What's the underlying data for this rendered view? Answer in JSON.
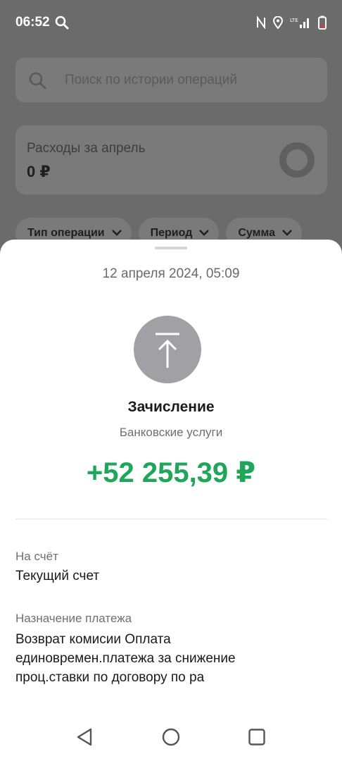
{
  "status_bar": {
    "time": "06:52",
    "icons": [
      "search-icon",
      "nfc-icon",
      "location-icon",
      "lte-signal-icon",
      "battery-low-icon"
    ]
  },
  "history": {
    "search_placeholder": "Поиск по истории операций",
    "expenses_label": "Расходы за апрель",
    "expenses_value": "0 ₽",
    "filters": [
      "Тип операции",
      "Период",
      "Сумма"
    ]
  },
  "operation": {
    "date": "12 апреля 2024, 05:09",
    "icon": "arrow-up-icon",
    "title": "Зачисление",
    "subtitle": "Банковские услуги",
    "amount": "+52 255,39 ₽",
    "amount_color": "#1fa65a",
    "account_label": "На счёт",
    "account_value": "Текущий счет",
    "purpose_label": "Назначение платежа",
    "purpose_value": "Возврат комисии Оплата единовремен.платежа за снижение проц.ставки по договору по ра"
  },
  "nav": [
    "back-icon",
    "home-icon",
    "recents-icon"
  ]
}
